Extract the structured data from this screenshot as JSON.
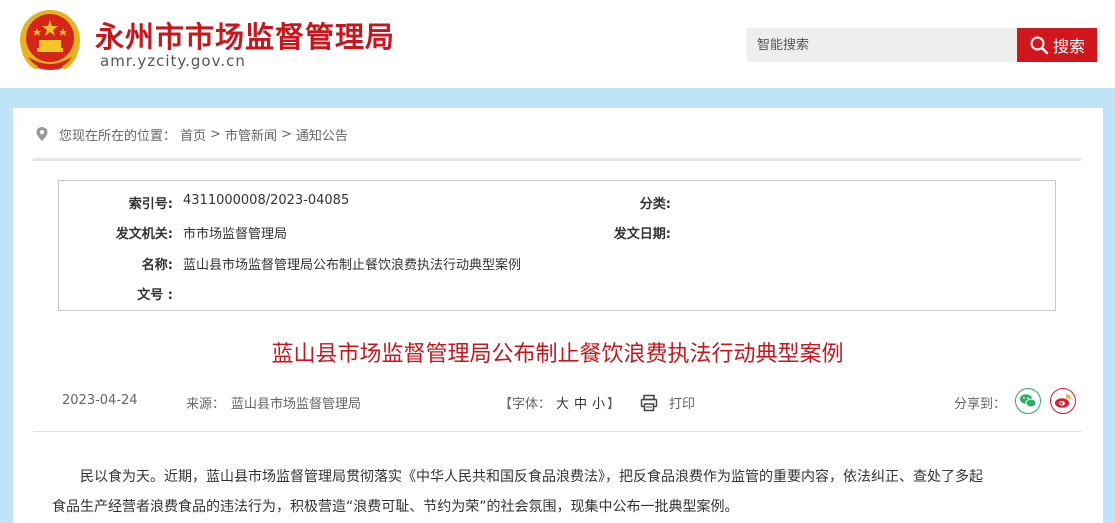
{
  "header": {
    "site_title": "永州市市场监督管理局",
    "site_url": "amr.yzcity.gov.cn",
    "search_placeholder": "智能搜索",
    "search_button_label": "搜索",
    "emblem_icon": "national-emblem-icon",
    "search_icon": "magnifier-icon"
  },
  "breadcrumb": {
    "icon": "location-pin-icon",
    "prefix": "您现在所在的位置：",
    "items": [
      "首页",
      "市管新闻",
      "通知公告"
    ],
    "separator": ">"
  },
  "meta": {
    "index_label": "索引号:",
    "index_value": "4311000008/2023-04085",
    "category_label": "分类:",
    "category_value": "",
    "issuer_label": "发文机关:",
    "issuer_value": "市市场监督管理局",
    "date_label": "发文日期:",
    "date_value": "",
    "name_label": "名称:",
    "name_value": "蓝山县市场监督管理局公布制止餐饮浪费执法行动典型案例",
    "docno_label": "文号 :",
    "docno_value": ""
  },
  "article": {
    "title": "蓝山县市场监督管理局公布制止餐饮浪费执法行动典型案例",
    "date": "2023-04-24",
    "source_label": "来源：",
    "source_value": "蓝山县市场监督管理局",
    "font_label": "【字体：",
    "font_large": "大",
    "font_medium": "中",
    "font_small": "小",
    "font_close": "】",
    "print_icon": "printer-icon",
    "print_label": "打印",
    "share_label": "分享到：",
    "share_wechat_icon": "wechat-icon",
    "share_weibo_icon": "weibo-icon",
    "paragraph1_line1": "民以食为天。近期，蓝山县市场监督管理局贯彻落实《中华人民共和国反食品浪费法》，把反食品浪费作为监管的重要内容，依法纠正、查处了多起",
    "paragraph1_line2": "食品生产经营者浪费食品的违法行为，积极营造“浪费可耻、节约为荣”的社会氛围，现集中公布一批典型案例。"
  },
  "colors": {
    "brand_red": "#c8161d",
    "band_blue": "#bfe4f7",
    "wechat_green": "#2aae67",
    "weibo_red": "#e6162d"
  }
}
